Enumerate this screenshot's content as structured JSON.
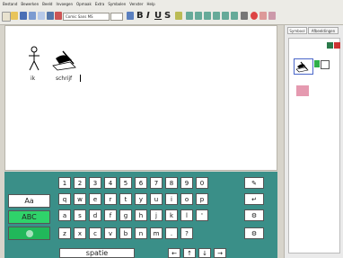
{
  "menubar": {
    "items": [
      "Bestand",
      "Bewerken",
      "Beeld",
      "Invoegen",
      "Opmaak",
      "Extra",
      "Symbolen",
      "Venster",
      "Help"
    ]
  },
  "toolbar": {
    "font_name": "Comic Sans MS",
    "bold": "B",
    "italic": "I",
    "underline": "U",
    "strike": "S"
  },
  "document": {
    "words": [
      {
        "label": "ik"
      },
      {
        "label": "schrijf"
      }
    ]
  },
  "right_panel": {
    "tabs": [
      "Symbool",
      "Afbeeldingen"
    ]
  },
  "keyboard": {
    "rows": [
      [
        "1",
        "2",
        "3",
        "4",
        "5",
        "6",
        "7",
        "8",
        "9",
        "0"
      ],
      [
        "q",
        "w",
        "e",
        "r",
        "t",
        "y",
        "u",
        "i",
        "o",
        "p"
      ],
      [
        "a",
        "s",
        "d",
        "f",
        "g",
        "h",
        "j",
        "k",
        "l",
        "'"
      ],
      [
        "z",
        "x",
        "c",
        "v",
        "b",
        "n",
        "m",
        ".",
        "?"
      ]
    ],
    "aa_label": "Aa",
    "abc_label": "ABC",
    "space_label": "spatie",
    "arrows": [
      "←",
      "↑",
      "↓",
      "→"
    ],
    "colors": {
      "background": "#3a8f88",
      "abc_key": "#2fd36a",
      "symbol_key": "#21b85a"
    }
  }
}
